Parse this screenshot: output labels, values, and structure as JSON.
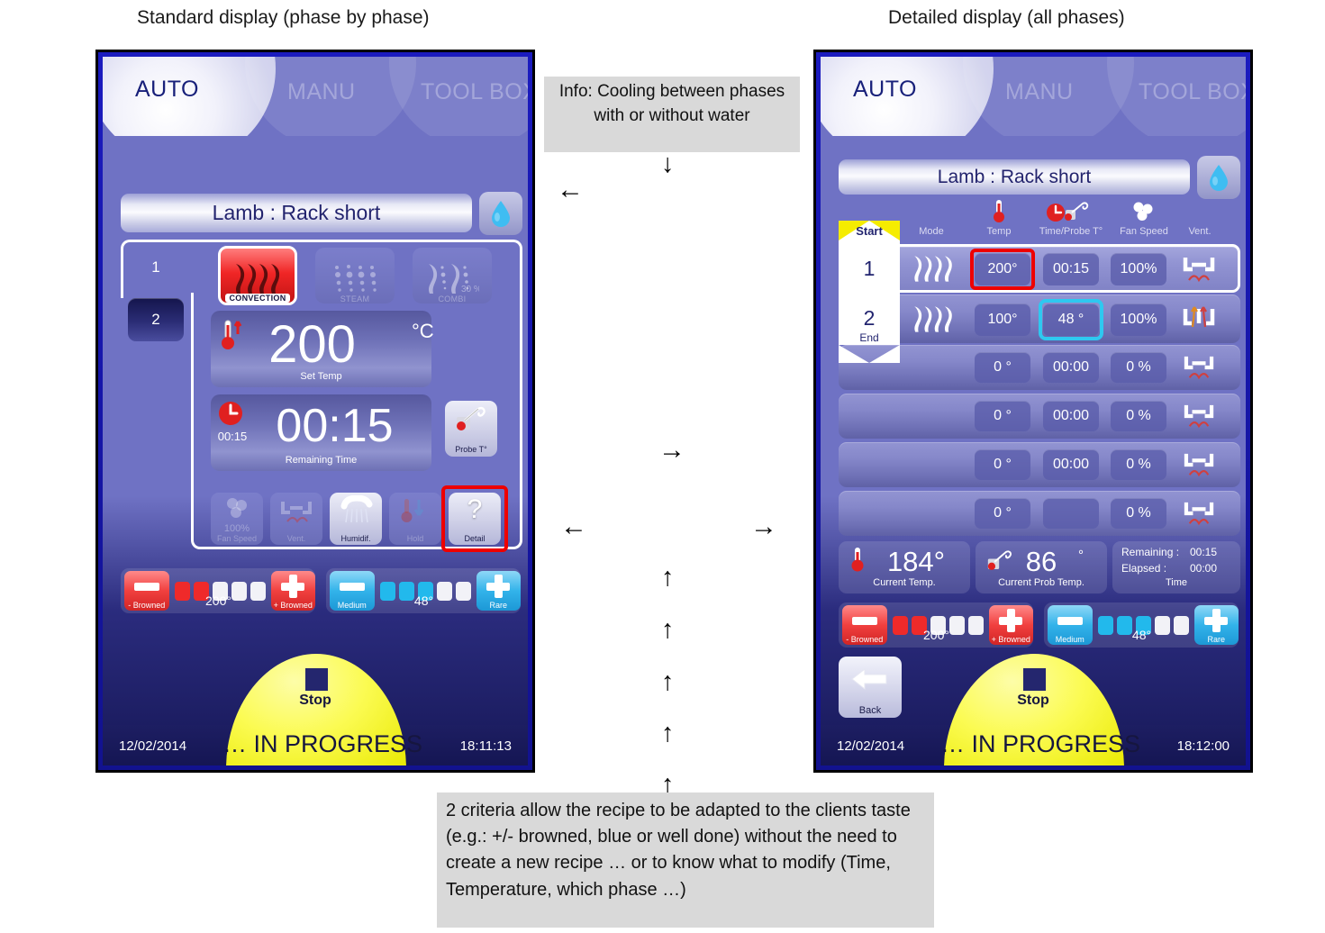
{
  "titles": {
    "left": "Standard display (phase by phase)",
    "right": "Detailed display (all phases)"
  },
  "annotations": {
    "info_top": "Info: Cooling between phases with or without water",
    "info_bottom": "2 criteria allow the recipe to be adapted to the clients taste  (e.g.: +/- browned, blue or well done) without the need to create a new recipe … or to know what to modify (Time, Temperature, which phase …)"
  },
  "tabs": {
    "auto": "AUTO",
    "manu": "MANU",
    "toolbox": "TOOL BOX"
  },
  "recipe": {
    "name": "Lamb : Rack short",
    "water_icon": "water-drop-icon"
  },
  "standard": {
    "phases": [
      {
        "number": "1",
        "selected": true
      },
      {
        "number": "2",
        "selected": false
      }
    ],
    "modes": [
      {
        "label": "CONVECTION",
        "active": true,
        "icon": "convection-waves-icon",
        "extra": ""
      },
      {
        "label": "STEAM",
        "active": false,
        "icon": "steam-dots-icon",
        "extra": ""
      },
      {
        "label": "COMBI",
        "active": false,
        "icon": "combi-icon",
        "extra": "30 %"
      }
    ],
    "set_temp": {
      "value": "200",
      "unit": "°C",
      "label": "Set Temp",
      "icon": "thermometer-icon"
    },
    "remaining": {
      "value": "00:15",
      "small": "00:15",
      "label": "Remaining Time",
      "icon": "clock-icon"
    },
    "probe_button": {
      "label": "Probe T°",
      "icon": "probe-icon"
    },
    "functions": [
      {
        "label": "Fan Speed",
        "value": "100%",
        "icon": "fan-icon",
        "enabled": false,
        "highlight": false
      },
      {
        "label": "Vent.",
        "value": "",
        "icon": "vent-icon",
        "enabled": false,
        "highlight": false
      },
      {
        "label": "Humidif.",
        "value": "",
        "icon": "shower-icon",
        "enabled": true,
        "highlight": false
      },
      {
        "label": "Hold",
        "value": "",
        "icon": "hold-icon",
        "enabled": false,
        "highlight": false
      },
      {
        "label": "Detail",
        "value": "?",
        "icon": "question-icon",
        "enabled": true,
        "highlight": true
      }
    ],
    "criteria": [
      {
        "minus_label": "- Browned",
        "plus_label": "+ Browned",
        "value": "200°",
        "filled": 2,
        "total": 5,
        "color": "#ef2a2a"
      },
      {
        "minus_label": "Medium",
        "plus_label": "Rare",
        "value": "48°",
        "filled": 3,
        "total": 5,
        "color": "#22b9ec"
      }
    ],
    "stop_label": "Stop",
    "status": {
      "date": "12/02/2014",
      "progress": "… IN PROGRESS",
      "time": "18:11:13"
    }
  },
  "detailed": {
    "column_headers": [
      "Mode",
      "Temp",
      "Time/Probe T°",
      "Fan Speed",
      "Vent."
    ],
    "header_icons": [
      "",
      "thermometer-icon",
      "clock-probe-icon",
      "fan-icon",
      ""
    ],
    "ribbon": {
      "start": "Start",
      "end": "End"
    },
    "rows": [
      {
        "phase": "1",
        "mode": "convection-waves-icon",
        "temp": "200°",
        "time": "00:15",
        "fan": "100%",
        "vent": "vent-closed-icon",
        "active": true,
        "temp_highlight": "red",
        "time_highlight": ""
      },
      {
        "phase": "2",
        "mode": "convection-waves-icon",
        "temp": "100°",
        "time": "48 °",
        "fan": "100%",
        "vent": "vent-open-icon",
        "active": false,
        "temp_highlight": "",
        "time_highlight": "cyan"
      },
      {
        "phase": "",
        "mode": "",
        "temp": "0  °",
        "time": "00:00",
        "fan": "0  %",
        "vent": "vent-closed-icon",
        "active": false,
        "temp_highlight": "",
        "time_highlight": ""
      },
      {
        "phase": "",
        "mode": "",
        "temp": "0  °",
        "time": "00:00",
        "fan": "0  %",
        "vent": "vent-closed-icon",
        "active": false,
        "temp_highlight": "",
        "time_highlight": ""
      },
      {
        "phase": "",
        "mode": "",
        "temp": "0  °",
        "time": "00:00",
        "fan": "0  %",
        "vent": "vent-closed-icon",
        "active": false,
        "temp_highlight": "",
        "time_highlight": ""
      },
      {
        "phase": "",
        "mode": "",
        "temp": "0  °",
        "time": "",
        "fan": "0  %",
        "vent": "vent-closed-icon",
        "active": false,
        "temp_highlight": "",
        "time_highlight": ""
      }
    ],
    "current_temp": {
      "value": "184°",
      "label": "Current Temp.",
      "icon": "thermometer-icon"
    },
    "current_probe": {
      "value": "86",
      "unit": "°",
      "label": "Current Prob Temp.",
      "icon": "probe-icon"
    },
    "time_panel": {
      "remaining_label": "Remaining :",
      "remaining_value": "00:15",
      "elapsed_label": "Elapsed :",
      "elapsed_value": "00:00",
      "caption": "Time"
    },
    "criteria": [
      {
        "minus_label": "- Browned",
        "plus_label": "+ Browned",
        "value": "200°",
        "filled": 2,
        "total": 5,
        "color": "#ef2a2a"
      },
      {
        "minus_label": "Medium",
        "plus_label": "Rare",
        "value": "48°",
        "filled": 3,
        "total": 5,
        "color": "#22b9ec"
      }
    ],
    "back_label": "Back",
    "stop_label": "Stop",
    "status": {
      "date": "12/02/2014",
      "progress": "… IN PROGRESS",
      "time": "18:12:00"
    }
  },
  "arrows": {
    "down": "↓",
    "left": "←",
    "right": "→",
    "up": "↑"
  }
}
